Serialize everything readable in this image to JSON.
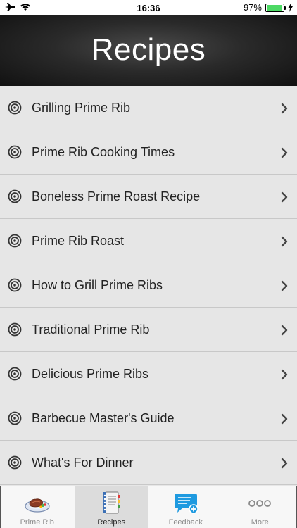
{
  "status": {
    "time": "16:36",
    "battery_text": "97%",
    "battery_level": 0.97
  },
  "header": {
    "title": "Recipes"
  },
  "recipes": [
    {
      "label": "Grilling Prime Rib"
    },
    {
      "label": "Prime Rib Cooking Times"
    },
    {
      "label": "Boneless Prime Roast Recipe"
    },
    {
      "label": "Prime Rib Roast"
    },
    {
      "label": "How to Grill Prime Ribs"
    },
    {
      "label": "Traditional Prime Rib"
    },
    {
      "label": "Delicious Prime Ribs"
    },
    {
      "label": "Barbecue Master's Guide"
    },
    {
      "label": "What's For Dinner"
    }
  ],
  "tabs": [
    {
      "label": "Prime Rib",
      "icon": "steak-plate-icon"
    },
    {
      "label": "Recipes",
      "icon": "recipe-book-icon",
      "active": true
    },
    {
      "label": "Feedback",
      "icon": "chat-bubble-plus-icon"
    },
    {
      "label": "More",
      "icon": "more-dots-icon"
    }
  ],
  "colors": {
    "battery": "#4cd964",
    "list_bg": "#e6e6e6",
    "feedback_blue": "#1e9ae0"
  }
}
